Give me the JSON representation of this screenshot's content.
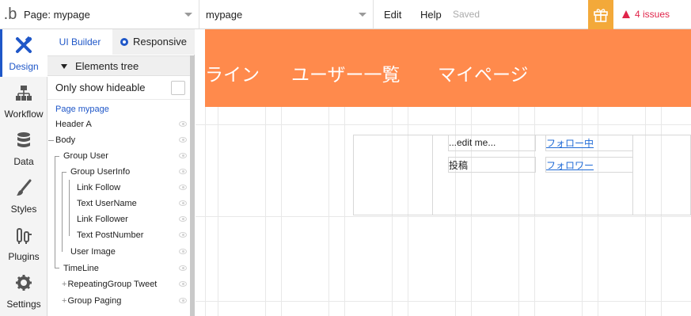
{
  "topbar": {
    "logo": ".b",
    "page_label": "Page: mypage",
    "element_label": "mypage",
    "edit": "Edit",
    "help": "Help",
    "saved": "Saved",
    "gift_icon": "gift-icon",
    "issues": "4 issues",
    "issues_color": "#e0244a"
  },
  "nav": [
    {
      "label": "Design",
      "icon": "design-icon"
    },
    {
      "label": "Workflow",
      "icon": "workflow-icon"
    },
    {
      "label": "Data",
      "icon": "data-icon"
    },
    {
      "label": "Styles",
      "icon": "styles-icon"
    },
    {
      "label": "Plugins",
      "icon": "plugins-icon"
    },
    {
      "label": "Settings",
      "icon": "settings-icon"
    }
  ],
  "panel": {
    "tab_ui": "UI Builder",
    "tab_responsive": "Responsive",
    "tree_title": "Elements tree",
    "only_hideable": "Only show hideable",
    "tree": [
      "Page mypage",
      "Header A",
      "Body",
      "Group User",
      "Group UserInfo",
      "Link Follow",
      "Text UserName",
      "Link Follower",
      "Text PostNumber",
      "User Image",
      "TimeLine",
      "RepeatingGroup Tweet",
      "Group Paging"
    ]
  },
  "canvas": {
    "header_items": [
      "ライン",
      "ユーザー一覧",
      "マイページ"
    ],
    "header_color": "#ff8a4c",
    "edit_me": "...edit me...",
    "posts": "投稿",
    "link_following": "フォロー中",
    "link_followers": "フォロワー"
  }
}
